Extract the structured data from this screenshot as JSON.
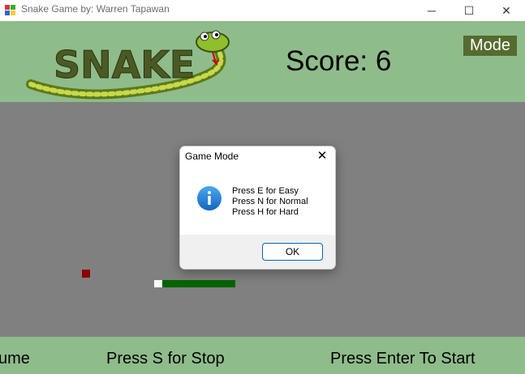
{
  "window": {
    "title": "Snake Game by: Warren Tapawan",
    "icon": "app-icon",
    "controls": {
      "minimize": "─",
      "maximize": "☐",
      "close": "✕"
    }
  },
  "header": {
    "logo_text": "SNAKE",
    "score_label": "Score: 6",
    "mode_button": "Mode",
    "colors": {
      "background": "#8fbc8b",
      "mode_button": "#556b2f"
    }
  },
  "playfield": {
    "background": "#808080",
    "food_color": "#8b0000",
    "snake_head_color": "#ffffff",
    "snake_body_color": "#006400"
  },
  "footer": {
    "resume_text": "ume",
    "stop_text": "Press S for Stop",
    "start_text": "Press Enter To Start"
  },
  "dialog": {
    "title": "Game Mode",
    "close": "✕",
    "icon": "info-icon",
    "lines": [
      "Press E for Easy",
      "Press N for Normal",
      "Press H for Hard"
    ],
    "ok_label": "OK"
  }
}
